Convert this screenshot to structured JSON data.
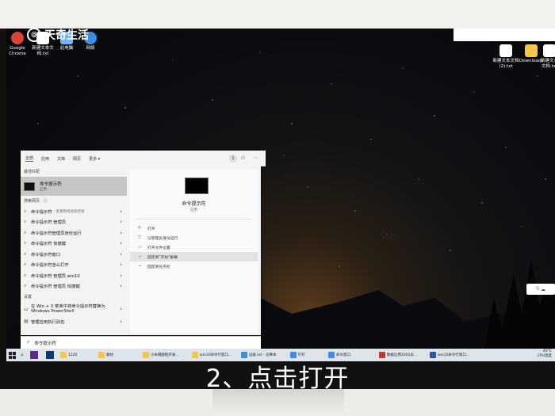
{
  "watermark": {
    "brand": "天奇生活"
  },
  "desktop": {
    "icons_left": [
      {
        "label": "Google\nChrome",
        "icon": "chrome-icon",
        "color": "#db4437"
      },
      {
        "label": "新建文本文\n档.txt",
        "icon": "text-file-icon",
        "color": "#ffffff"
      },
      {
        "label": "此电脑",
        "icon": "computer-icon",
        "color": "#6fb6ff"
      },
      {
        "label": "网络",
        "icon": "network-icon",
        "color": "#3a8fe0"
      }
    ],
    "icons_right": [
      {
        "label": "新建文本文档\n(2).txt",
        "icon": "text-file-icon",
        "color": "#ffffff"
      },
      {
        "label": "Downloads",
        "icon": "folder-icon",
        "color": "#f5c64d"
      },
      {
        "label": "新建文本文档.txt",
        "icon": "text-file-icon",
        "color": "#ffffff"
      }
    ]
  },
  "start_menu": {
    "tabs": [
      "全部",
      "应用",
      "文档",
      "网页",
      "更多 ▾"
    ],
    "badge": "1",
    "best_match_label": "最佳匹配",
    "best_match": {
      "title": "命令提示符",
      "subtitle": "应用"
    },
    "web_search_label": "搜索网页",
    "web_results": [
      {
        "text": "命令提示符",
        "hint": "- 查看网络搜索结果"
      },
      {
        "text": "命令提示符 管理员",
        "hint": ""
      },
      {
        "text": "命令提示符管理员身份运行",
        "hint": ""
      },
      {
        "text": "命令提示符 快捷键",
        "hint": ""
      },
      {
        "text": "命令提示符窗口",
        "hint": ""
      },
      {
        "text": "命令提示符怎么打开",
        "hint": ""
      },
      {
        "text": "命令提示符 管理员 win10",
        "hint": ""
      },
      {
        "text": "命令提示符 管理员 快捷键",
        "hint": ""
      }
    ],
    "settings_label": "设置",
    "settings_results": [
      {
        "text": "在 Win + X 菜单中将命令提示符替换为 Windows PowerShell"
      },
      {
        "text": "管理应用执行别名"
      }
    ],
    "preview": {
      "title": "命令提示符",
      "subtitle": "应用",
      "actions": [
        {
          "label": "打开",
          "icon": "open-icon"
        },
        {
          "label": "以管理员身份运行",
          "icon": "shield-icon"
        },
        {
          "label": "打开文件位置",
          "icon": "folder-icon"
        },
        {
          "label": "固定到\"开始\"屏幕",
          "icon": "pin-icon"
        },
        {
          "label": "固定到任务栏",
          "icon": "pin-icon"
        }
      ]
    }
  },
  "search": {
    "value": "命令提示符"
  },
  "taskbar": {
    "items": [
      {
        "label": "",
        "color": "#5a2d82"
      },
      {
        "label": "",
        "color": "#0b3b6b"
      },
      {
        "label": "1220",
        "color": "#f5c64d"
      },
      {
        "label": "素材",
        "color": "#f5c64d"
      },
      {
        "label": "小米帽题框开发...",
        "color": "#f5c64d"
      },
      {
        "label": "win10命令行窗口...",
        "color": "#f5c64d"
      },
      {
        "label": "设备.txt - 记事本",
        "color": "#3a8fe0"
      },
      {
        "label": "钉钉",
        "color": "#3a8fe0"
      },
      {
        "label": "命令窗口",
        "color": "#3a8fe0"
      },
      {
        "label": "数据应用2002女...",
        "color": "#c0392b"
      },
      {
        "label": "win10命令行窗口...",
        "color": "#2b579a"
      }
    ],
    "tray": {
      "temp": "40°C",
      "status": "CPU温度"
    }
  },
  "caption": "2、点击打开"
}
